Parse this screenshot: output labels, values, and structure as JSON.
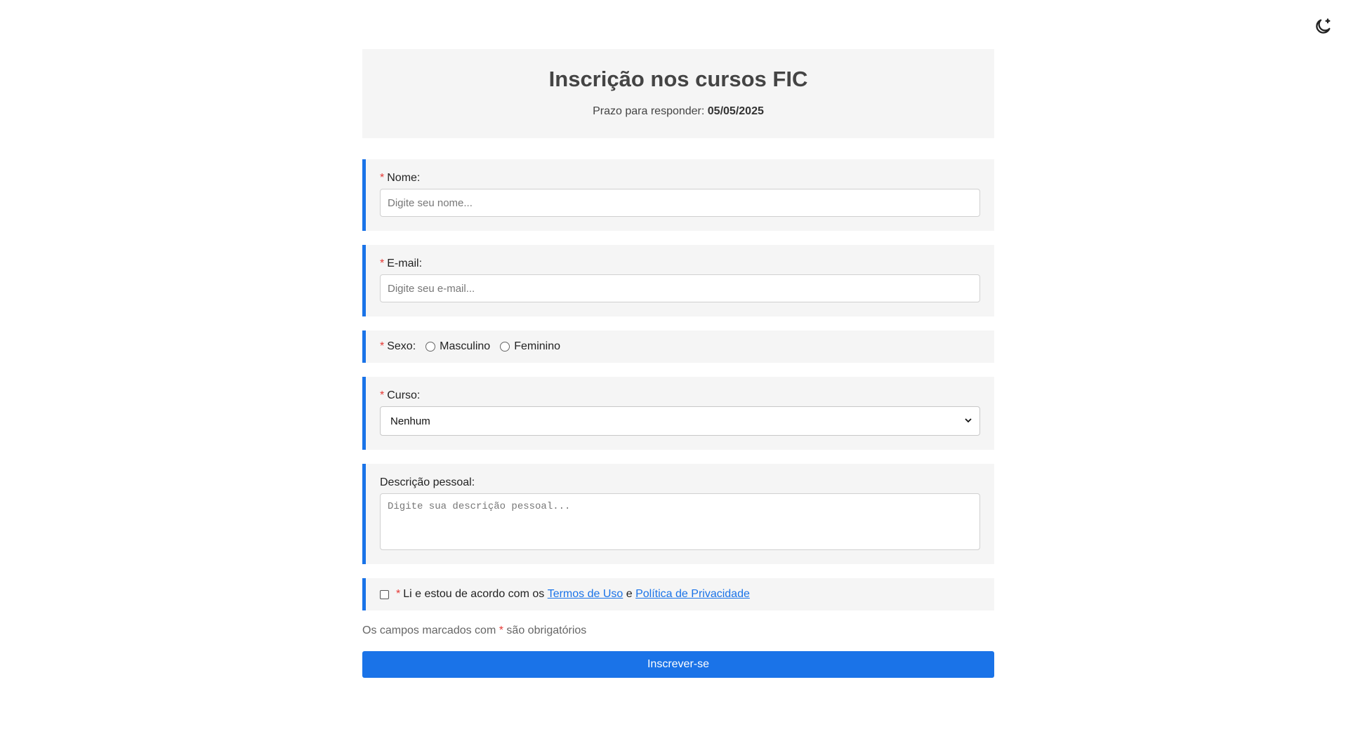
{
  "theme_toggle": {
    "icon": "moon-star-icon"
  },
  "header": {
    "title": "Inscrição nos cursos FIC",
    "deadline_label": "Prazo para responder:",
    "deadline_value": "05/05/2025"
  },
  "fields": {
    "nome": {
      "required_mark": "*",
      "label": "Nome:",
      "placeholder": "Digite seu nome...",
      "value": ""
    },
    "email": {
      "required_mark": "*",
      "label": "E-mail:",
      "placeholder": "Digite seu e-mail...",
      "value": ""
    },
    "sexo": {
      "required_mark": "*",
      "label": "Sexo:",
      "options": [
        "Masculino",
        "Feminino"
      ]
    },
    "curso": {
      "required_mark": "*",
      "label": "Curso:",
      "selected": "Nenhum"
    },
    "descricao": {
      "label": "Descrição pessoal:",
      "placeholder": "Digite sua descrição pessoal..."
    },
    "terms": {
      "required_mark": "*",
      "text_before": "Li e estou de acordo com os",
      "link_terms": "Termos de Uso",
      "text_and": "e",
      "link_privacy": "Política de Privacidade"
    }
  },
  "note": {
    "before": "Os campos marcados com",
    "mark": "*",
    "after": "são obrigatórios"
  },
  "submit_label": "Inscrever-se",
  "colors": {
    "accent": "#1a73e8",
    "required": "#e53935",
    "panel": "#f5f5f5"
  }
}
